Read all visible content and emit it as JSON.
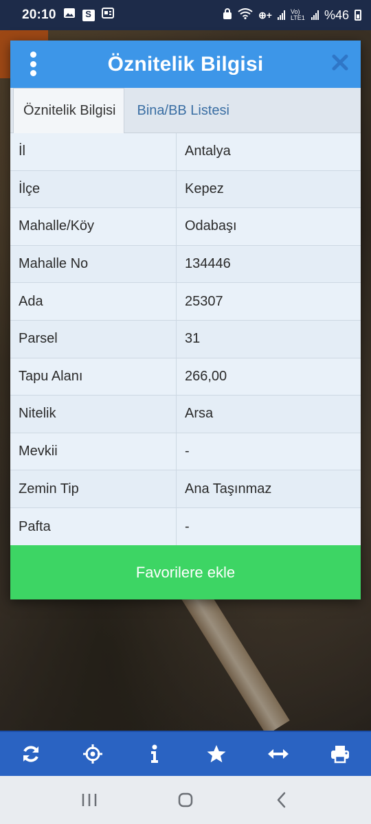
{
  "status_bar": {
    "time": "20:10",
    "network_label": "Vo) LTE1",
    "battery_text": "%46"
  },
  "dialog": {
    "title": "Öznitelik Bilgisi",
    "tabs": [
      {
        "label": "Öznitelik Bilgisi",
        "active": true
      },
      {
        "label": "Bina/BB Listesi",
        "active": false
      }
    ],
    "rows": [
      {
        "key": "İl",
        "value": "Antalya"
      },
      {
        "key": "İlçe",
        "value": "Kepez"
      },
      {
        "key": "Mahalle/Köy",
        "value": "Odabaşı"
      },
      {
        "key": "Mahalle No",
        "value": "134446"
      },
      {
        "key": "Ada",
        "value": "25307"
      },
      {
        "key": "Parsel",
        "value": "31"
      },
      {
        "key": "Tapu Alanı",
        "value": "266,00"
      },
      {
        "key": "Nitelik",
        "value": "Arsa"
      },
      {
        "key": "Mevkii",
        "value": "-"
      },
      {
        "key": "Zemin Tip",
        "value": "Ana Taşınmaz"
      },
      {
        "key": "Pafta",
        "value": "-"
      }
    ],
    "favorite_button": "Favorilere ekle"
  },
  "toolbar": {
    "items": [
      "refresh-icon",
      "locate-icon",
      "info-icon",
      "star-icon",
      "measure-icon",
      "print-icon"
    ]
  },
  "navbar": {
    "items": [
      "recent-apps-icon",
      "home-icon",
      "back-icon"
    ]
  },
  "colors": {
    "header_blue": "#3d96e8",
    "favorite_green": "#3dd564",
    "toolbar_blue": "#2a63c2",
    "status_bar": "#1d2b49"
  }
}
